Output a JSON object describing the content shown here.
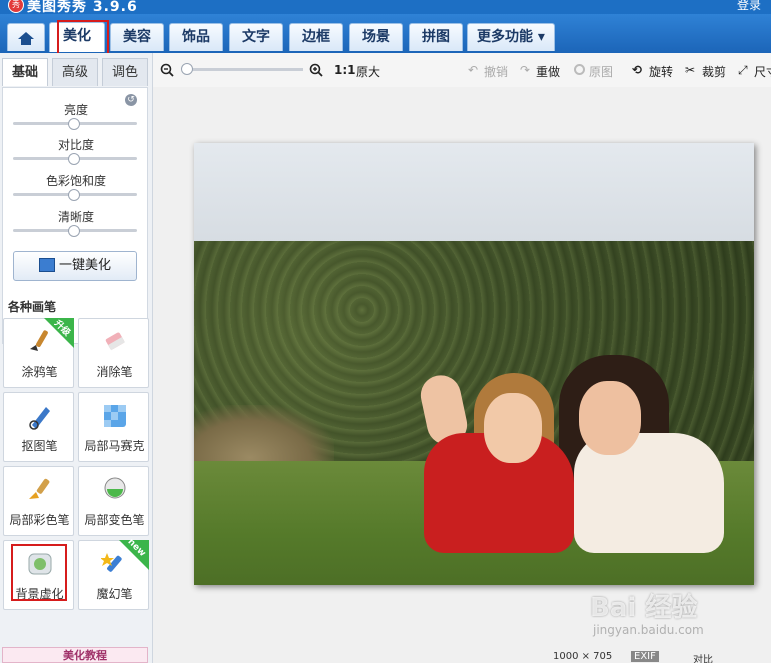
{
  "app": {
    "title": "美图秀秀 3.9.6",
    "login": "登录",
    "logo": "秀"
  },
  "main_tabs": [
    {
      "label": "美化"
    },
    {
      "label": "美容"
    },
    {
      "label": "饰品"
    },
    {
      "label": "文字"
    },
    {
      "label": "边框"
    },
    {
      "label": "场景"
    },
    {
      "label": "拼图"
    },
    {
      "label": "更多功能 ▾"
    }
  ],
  "sub_tabs": [
    "基础",
    "高级",
    "调色"
  ],
  "adjustments": [
    {
      "label": "亮度",
      "value": 0.5
    },
    {
      "label": "对比度",
      "value": 0.5
    },
    {
      "label": "色彩饱和度",
      "value": 0.5
    },
    {
      "label": "清晰度",
      "value": 0.5
    }
  ],
  "one_key_button": "一键美化",
  "pens_title": "各种画笔",
  "tools": [
    {
      "label": "涂鸦笔",
      "badge": "升级",
      "icon": "brush-icon"
    },
    {
      "label": "消除笔",
      "badge": "",
      "icon": "eraser-icon"
    },
    {
      "label": "抠图笔",
      "badge": "",
      "icon": "cutout-pen-icon"
    },
    {
      "label": "局部马赛克",
      "badge": "",
      "icon": "mosaic-icon"
    },
    {
      "label": "局部彩色笔",
      "badge": "",
      "icon": "color-brush-icon"
    },
    {
      "label": "局部变色笔",
      "badge": "",
      "icon": "recolor-pen-icon"
    },
    {
      "label": "背景虚化",
      "badge": "",
      "icon": "blur-background-icon"
    },
    {
      "label": "魔幻笔",
      "badge": "new",
      "icon": "magic-pen-icon"
    }
  ],
  "tutorial": "美化教程",
  "toolbar": {
    "zoom_ratio": "1:1",
    "original_size": "原大",
    "undo": "撤销",
    "redo": "重做",
    "original": "原图",
    "rotate": "旋转",
    "crop": "裁剪",
    "resize": "尺寸"
  },
  "status": {
    "dimensions": "1000 × 705",
    "exif": "EXIF",
    "compare": "对比"
  },
  "watermark": {
    "brand": "Bai 经验",
    "url": "jingyan.baidu.com"
  },
  "colors": {
    "title_bar": "#1d6fc4",
    "tab_bar": "#1c65b8",
    "highlight_box": "#d61c1c",
    "badge_green": "#3bb54a"
  }
}
